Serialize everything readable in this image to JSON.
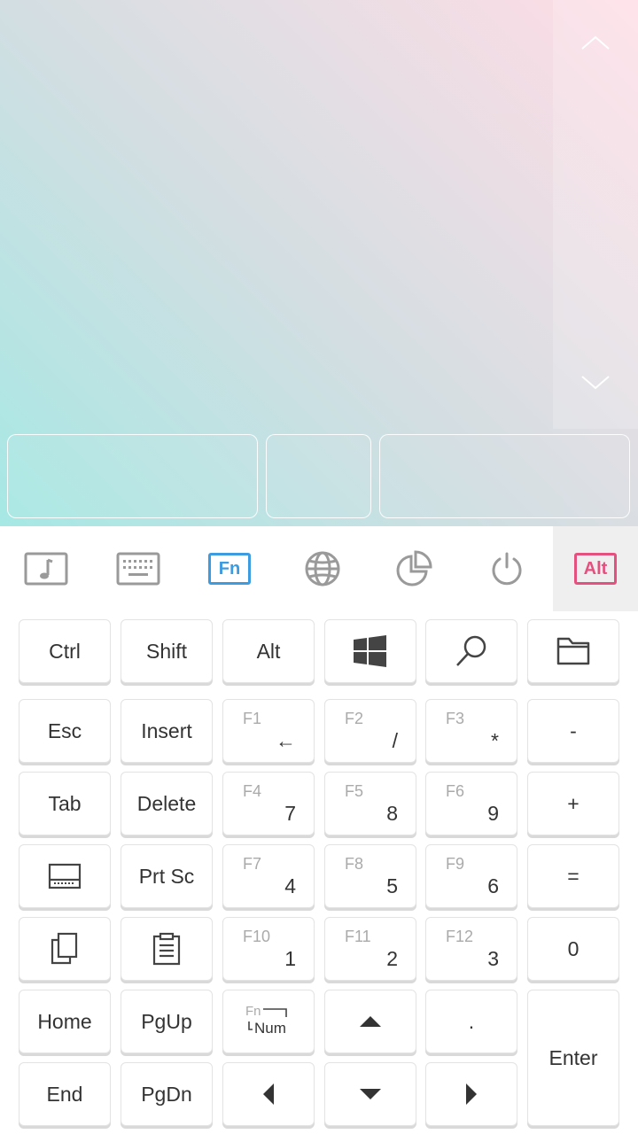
{
  "toolbar": {
    "items": [
      {
        "icon": "music-icon"
      },
      {
        "icon": "keyboard-icon"
      },
      {
        "icon": "fn-icon",
        "label": "Fn",
        "color": "#3d9be0"
      },
      {
        "icon": "globe-icon"
      },
      {
        "icon": "pie-chart-icon"
      },
      {
        "icon": "power-icon"
      },
      {
        "icon": "alt-icon",
        "label": "Alt",
        "color": "#e4517f"
      }
    ]
  },
  "keys": {
    "ctrl": "Ctrl",
    "shift": "Shift",
    "alt": "Alt",
    "esc": "Esc",
    "insert": "Insert",
    "tab": "Tab",
    "delete": "Delete",
    "prtsc": "Prt Sc",
    "home": "Home",
    "pgup": "PgUp",
    "end": "End",
    "pgdn": "PgDn",
    "enter": "Enter",
    "minus": "-",
    "plus": "+",
    "equals": "=",
    "zero": "0",
    "dot": ".",
    "fn_num_fn": "Fn",
    "fn_num_num": "Num",
    "f1": {
      "fn": "F1",
      "num": "←"
    },
    "f2": {
      "fn": "F2",
      "num": "/"
    },
    "f3": {
      "fn": "F3",
      "num": "*"
    },
    "f4": {
      "fn": "F4",
      "num": "7"
    },
    "f5": {
      "fn": "F5",
      "num": "8"
    },
    "f6": {
      "fn": "F6",
      "num": "9"
    },
    "f7": {
      "fn": "F7",
      "num": "4"
    },
    "f8": {
      "fn": "F8",
      "num": "5"
    },
    "f9": {
      "fn": "F9",
      "num": "6"
    },
    "f10": {
      "fn": "F10",
      "num": "1"
    },
    "f11": {
      "fn": "F11",
      "num": "2"
    },
    "f12": {
      "fn": "F12",
      "num": "3"
    }
  },
  "colors": {
    "accent_fn": "#3d9be0",
    "accent_alt": "#e4517f",
    "icon_gray": "#9a9a9a",
    "text": "#333333"
  }
}
